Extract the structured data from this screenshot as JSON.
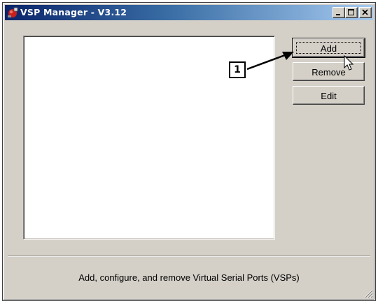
{
  "window": {
    "title": "VSP Manager - V3.12",
    "app_icon": "vsp-manager-app-icon",
    "controls": [
      "minimize-icon",
      "maximize-icon",
      "close-icon"
    ]
  },
  "buttons": {
    "add_label": "Add",
    "remove_label": "Remove",
    "edit_label": "Edit"
  },
  "port_list": {
    "items": []
  },
  "status": {
    "text": "Add, configure, and remove Virtual Serial Ports (VSPs)"
  },
  "annotation": {
    "callout_number": "1"
  },
  "colors": {
    "title_bar_start": "#0a246a",
    "title_bar_end": "#a6caf0",
    "window_face": "#d4d0c8"
  }
}
